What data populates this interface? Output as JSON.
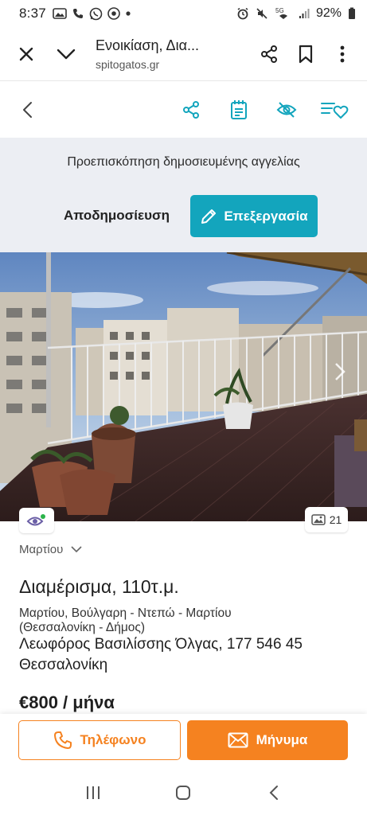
{
  "status_bar": {
    "time": "8:37",
    "network": "5G",
    "battery": "92%",
    "icons": [
      "photos-icon",
      "phone-icon",
      "whatsapp-icon",
      "chrome-icon",
      "dot-icon",
      "alarm-icon",
      "mute-icon",
      "wifi-icon",
      "signal-icon",
      "battery-icon"
    ]
  },
  "browser": {
    "title": "Ενοικίαση, Δια...",
    "url": "spitogatos.gr"
  },
  "preview": {
    "text": "Προεπισκόπηση δημοσιευμένης αγγελίας",
    "unpublish_label": "Αποδημοσίευση",
    "edit_label": "Επεξεργασία"
  },
  "photo": {
    "photo_count": "21"
  },
  "listing": {
    "area_dropdown": "Μαρτίου",
    "title": "Διαμέρισμα, 110τ.μ.",
    "location_line1": "Μαρτίου, Βούλγαρη - Ντεπώ - Μαρτίου",
    "location_line2": "(Θεσσαλονίκη - Δήμος)",
    "address_line1": "Λεωφόρος Βασιλίσσης Όλγας, 177 546 45",
    "address_line2": "Θεσσαλονίκη",
    "price": "€800 / μήνα"
  },
  "actions": {
    "phone_label": "Τηλέφωνο",
    "message_label": "Μήνυμα"
  },
  "colors": {
    "accent_teal": "#13a5bd",
    "accent_orange": "#f58220",
    "panel_bg": "#eceef3"
  }
}
